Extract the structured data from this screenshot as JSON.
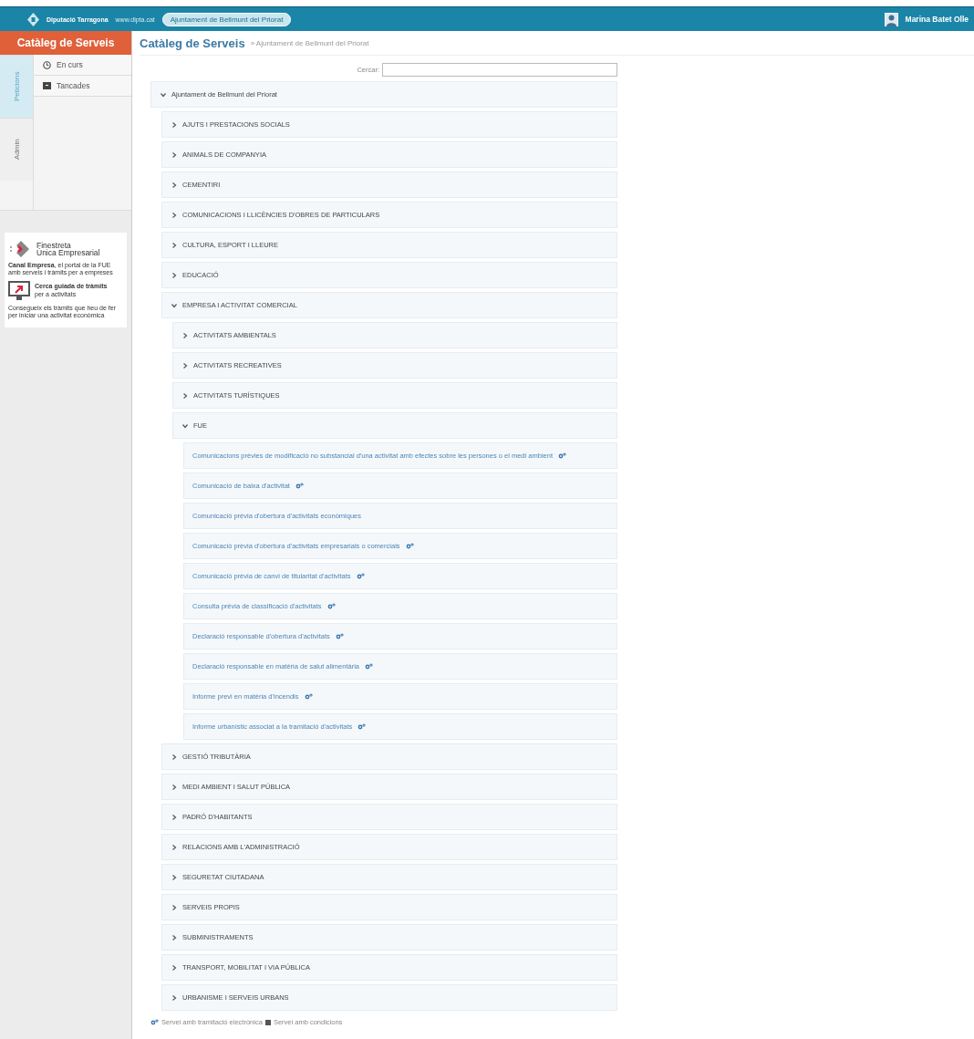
{
  "top_bar": {
    "brand": "Diputació Tarragona",
    "site": "www.dipta.cat",
    "entity_pill": "Ajuntament de Bellmunt del Priorat",
    "user": "Marina Batet Olle"
  },
  "sidebar": {
    "title": "Catàleg de Serveis",
    "vertical_tabs": [
      {
        "label": "Peticions",
        "selected": true
      },
      {
        "label": "Admin",
        "selected": false
      }
    ],
    "menu": [
      {
        "label": "En curs",
        "kind": "clock"
      },
      {
        "label": "Tancades",
        "kind": "archive"
      }
    ],
    "promo": {
      "title_1": "Finestreta",
      "title_2": "Única Empresarial",
      "text": "**Canal Empresa**, el portal de la FUE amb serveis i tràmits per a empreses",
      "guide_title": "Cerca guiada de tràmits",
      "guide_sub": "per a activitats",
      "guide_text": "Consegueix els tràmits que heu de fer per iniciar una activitat econòmica"
    }
  },
  "header": {
    "title": "Catàleg de Serveis",
    "breadcrumb": "» Ajuntament de Bellmunt del Priorat"
  },
  "search": {
    "label": "Cercar:"
  },
  "tree": [
    {
      "label": "Ajuntament de Bellmunt del Priorat",
      "kind": "category",
      "expanded": true,
      "children": [
        {
          "label": "AJUTS I PRESTACIONS SOCIALS",
          "kind": "category",
          "expanded": false
        },
        {
          "label": "ANIMALS DE COMPANYIA",
          "kind": "category",
          "expanded": false
        },
        {
          "label": "CEMENTIRI",
          "kind": "category",
          "expanded": false
        },
        {
          "label": "COMUNICACIONS I LLICÈNCIES D'OBRES DE PARTICULARS",
          "kind": "category",
          "expanded": false
        },
        {
          "label": "CULTURA, ESPORT I LLEURE",
          "kind": "category",
          "expanded": false
        },
        {
          "label": "EDUCACIÓ",
          "kind": "category",
          "expanded": false
        },
        {
          "label": "EMPRESA I ACTIVITAT COMERCIAL",
          "kind": "category",
          "expanded": true,
          "children": [
            {
              "label": "ACTIVITATS AMBIENTALS",
              "kind": "category",
              "expanded": false
            },
            {
              "label": "ACTIVITATS RECREATIVES",
              "kind": "category",
              "expanded": false
            },
            {
              "label": "ACTIVITATS TURÍSTIQUES",
              "kind": "category",
              "expanded": false
            },
            {
              "label": "FUE",
              "kind": "category",
              "expanded": true,
              "children": [
                {
                  "label": "Comunicacions prèvies de modificació no substancial d'una activitat amb efectes sobre les persones o el medi ambient",
                  "kind": "service",
                  "electronic": true
                },
                {
                  "label": "Comunicació de baixa d'activitat",
                  "kind": "service",
                  "electronic": true
                },
                {
                  "label": "Comunicació prèvia d'obertura d'activitats econòmiques",
                  "kind": "service",
                  "electronic": false
                },
                {
                  "label": "Comunicació prèvia d'obertura d'activitats empresarials o comercials",
                  "kind": "service",
                  "electronic": true
                },
                {
                  "label": "Comunicació prèvia de canvi de titularitat d'activitats",
                  "kind": "service",
                  "electronic": true
                },
                {
                  "label": "Consulta prèvia de classificació d'activitats",
                  "kind": "service",
                  "electronic": true
                },
                {
                  "label": "Declaració responsable d'obertura d'activitats",
                  "kind": "service",
                  "electronic": true
                },
                {
                  "label": "Declaració responsable en matèria de salut alimentària",
                  "kind": "service",
                  "electronic": true
                },
                {
                  "label": "Informe previ en matèria d'incendis",
                  "kind": "service",
                  "electronic": true
                },
                {
                  "label": "Informe urbanístic associat a la tramitació d'activitats",
                  "kind": "service",
                  "electronic": true
                }
              ]
            }
          ]
        },
        {
          "label": "GESTIÓ TRIBUTÀRIA",
          "kind": "category",
          "expanded": false
        },
        {
          "label": "MEDI AMBIENT I SALUT PÚBLICA",
          "kind": "category",
          "expanded": false
        },
        {
          "label": "PADRÓ D'HABITANTS",
          "kind": "category",
          "expanded": false
        },
        {
          "label": "RELACIONS AMB L'ADMINISTRACIÓ",
          "kind": "category",
          "expanded": false
        },
        {
          "label": "SEGURETAT CIUTADANA",
          "kind": "category",
          "expanded": false
        },
        {
          "label": "SERVEIS PROPIS",
          "kind": "category",
          "expanded": false
        },
        {
          "label": "SUBMINISTRAMENTS",
          "kind": "category",
          "expanded": false
        },
        {
          "label": "TRANSPORT, MOBILITAT I VIA PÚBLICA",
          "kind": "category",
          "expanded": false
        },
        {
          "label": "URBANISME I SERVEIS URBANS",
          "kind": "category",
          "expanded": false
        }
      ]
    }
  ],
  "legend": [
    {
      "label": "Servei amb tramitació electrònica",
      "kind": "electronic"
    },
    {
      "label": "Servei amb condicions",
      "kind": "conditions"
    }
  ]
}
